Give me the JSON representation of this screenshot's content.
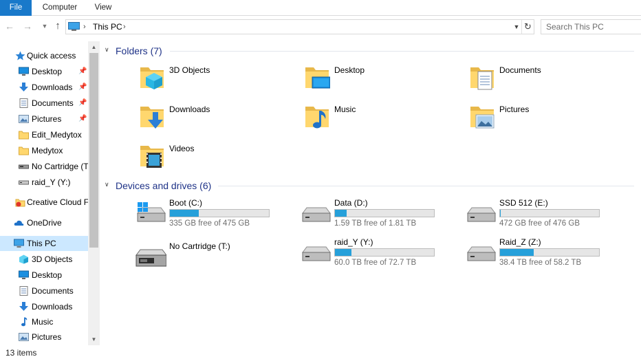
{
  "ribbon": {
    "tabs": [
      "File",
      "Computer",
      "View"
    ]
  },
  "address": {
    "path": "This PC",
    "search_placeholder": "Search This PC"
  },
  "sidebar": {
    "items": [
      {
        "label": "Quick access",
        "icon": "star-icon",
        "pinned": false
      },
      {
        "label": "Desktop",
        "icon": "desktop-icon",
        "pinned": true
      },
      {
        "label": "Downloads",
        "icon": "downloads-icon",
        "pinned": true
      },
      {
        "label": "Documents",
        "icon": "documents-icon",
        "pinned": true
      },
      {
        "label": "Pictures",
        "icon": "pictures-icon",
        "pinned": true
      },
      {
        "label": "Edit_Medytox",
        "icon": "folder-icon",
        "pinned": false
      },
      {
        "label": "Medytox",
        "icon": "folder-icon",
        "pinned": false
      },
      {
        "label": "No Cartridge (T:)",
        "icon": "cartridge-drive-icon",
        "pinned": false
      },
      {
        "label": "raid_Y (Y:)",
        "icon": "drive-icon",
        "pinned": false
      },
      {
        "label": "Creative Cloud Fil",
        "icon": "creative-cloud-icon",
        "pinned": false
      },
      {
        "label": "OneDrive",
        "icon": "onedrive-icon",
        "pinned": false
      },
      {
        "label": "This PC",
        "icon": "this-pc-icon",
        "pinned": false,
        "selected": true
      },
      {
        "label": "3D Objects",
        "icon": "3d-objects-icon",
        "pinned": false
      },
      {
        "label": "Desktop",
        "icon": "desktop-icon",
        "pinned": false
      },
      {
        "label": "Documents",
        "icon": "documents-icon",
        "pinned": false
      },
      {
        "label": "Downloads",
        "icon": "downloads-icon",
        "pinned": false
      },
      {
        "label": "Music",
        "icon": "music-icon",
        "pinned": false
      },
      {
        "label": "Pictures",
        "icon": "pictures-icon",
        "pinned": false
      }
    ]
  },
  "folders": {
    "title": "Folders (7)",
    "items": [
      {
        "label": "3D Objects",
        "icon": "3d-objects-folder-icon"
      },
      {
        "label": "Desktop",
        "icon": "desktop-folder-icon"
      },
      {
        "label": "Documents",
        "icon": "documents-folder-icon"
      },
      {
        "label": "Downloads",
        "icon": "downloads-folder-icon"
      },
      {
        "label": "Music",
        "icon": "music-folder-icon"
      },
      {
        "label": "Pictures",
        "icon": "pictures-folder-icon"
      },
      {
        "label": "Videos",
        "icon": "videos-folder-icon"
      }
    ]
  },
  "drives": {
    "title": "Devices and drives (6)",
    "items": [
      {
        "name": "Boot (C:)",
        "free": "335 GB free of 475 GB",
        "used_fraction": 0.29,
        "icon": "windows-drive-icon"
      },
      {
        "name": "Data (D:)",
        "free": "1.59 TB free of 1.81 TB",
        "used_fraction": 0.12,
        "icon": "drive-icon"
      },
      {
        "name": "SSD 512 (E:)",
        "free": "472 GB free of 476 GB",
        "used_fraction": 0.01,
        "icon": "drive-icon"
      },
      {
        "name": "No Cartridge (T:)",
        "free": "",
        "used_fraction": null,
        "icon": "cartridge-drive-icon"
      },
      {
        "name": "raid_Y (Y:)",
        "free": "60.0 TB free of 72.7 TB",
        "used_fraction": 0.17,
        "icon": "drive-icon"
      },
      {
        "name": "Raid_Z (Z:)",
        "free": "38.4 TB free of 58.2 TB",
        "used_fraction": 0.34,
        "icon": "drive-icon"
      }
    ]
  },
  "status": {
    "count": "13 items"
  },
  "colors": {
    "accent": "#1979ca",
    "selection": "#cce8ff",
    "capacity_bar": "#26a0da",
    "group_title": "#1e3287"
  }
}
